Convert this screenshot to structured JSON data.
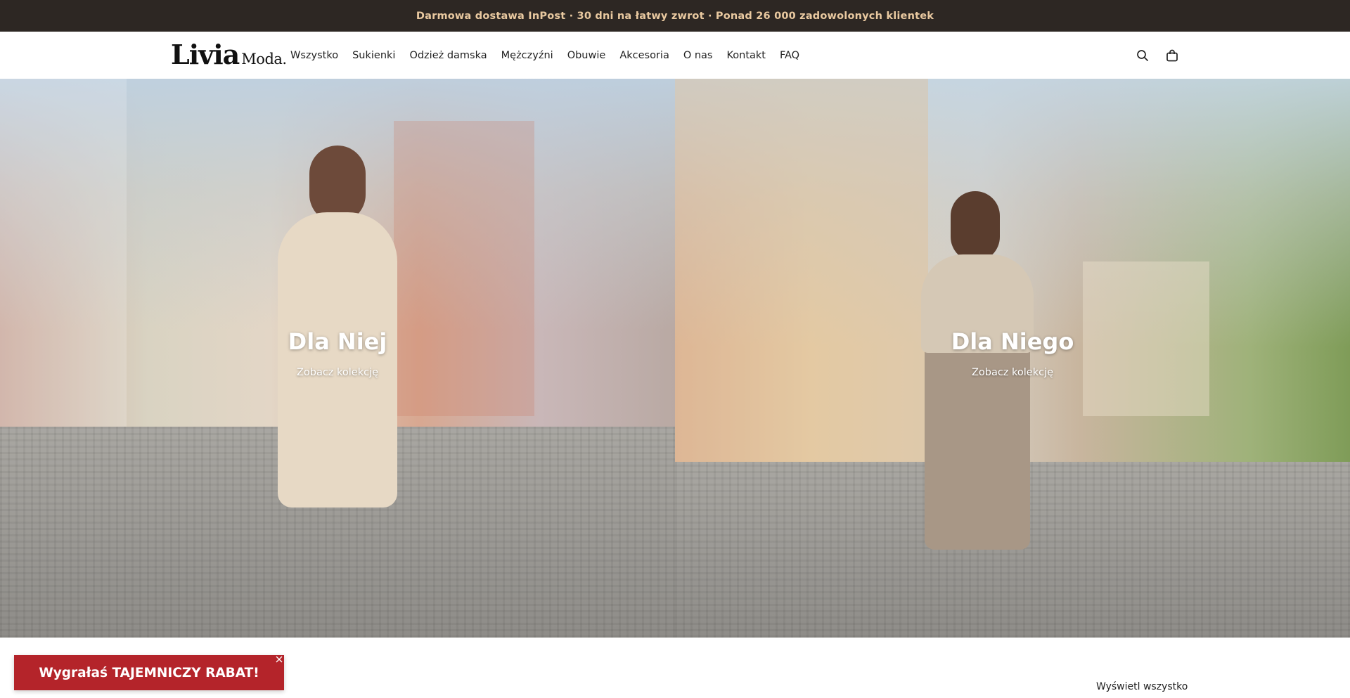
{
  "announcement": {
    "text": "Darmowa dostawa InPost · 30 dni na łatwy zwrot · Ponad 26 000 zadowolonych klientek"
  },
  "header": {
    "logo_main": "Livia",
    "logo_sub": "Moda.",
    "nav": [
      {
        "label": "Wszystko"
      },
      {
        "label": "Sukienki"
      },
      {
        "label": "Odzież damska"
      },
      {
        "label": "Mężczyźni"
      },
      {
        "label": "Obuwie"
      },
      {
        "label": "Akcesoria"
      },
      {
        "label": "O nas"
      },
      {
        "label": "Kontakt"
      },
      {
        "label": "FAQ"
      }
    ],
    "icons": [
      "search-icon",
      "shopping-bag-icon"
    ]
  },
  "hero": {
    "left": {
      "title": "Dla Niej",
      "link": "Zobacz kolekcję"
    },
    "right": {
      "title": "Dla Niego",
      "link": "Zobacz kolekcję"
    }
  },
  "collection": {
    "view_all": "Wyświetl wszystko"
  },
  "promo": {
    "label": "Wygrałaś TAJEMNICZY RABAT!",
    "background": "#b4242a"
  },
  "colors": {
    "announcement_bg": "#2d2723",
    "announcement_text": "#e9c9a0"
  }
}
